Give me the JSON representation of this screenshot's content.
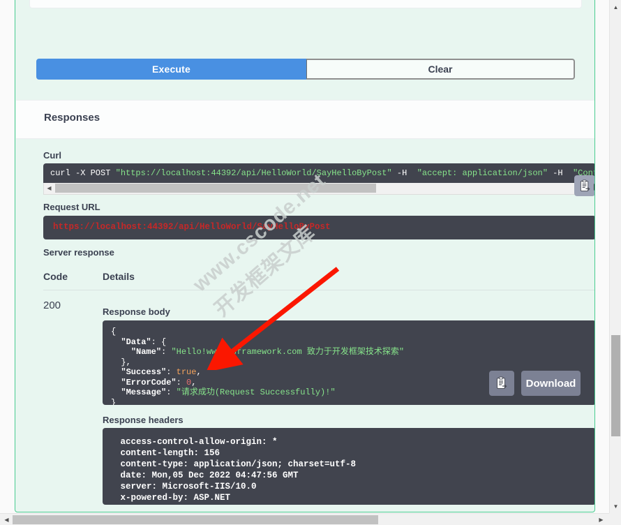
{
  "colors": {
    "execute_blue": "#4990e2",
    "opblock_border_green": "#49cc90",
    "opblock_bg": "#e8f6f0",
    "code_bg": "#41444e",
    "button_grey": "#7c8194",
    "json_string_green": "#86e38a",
    "json_bool_orange": "#f5a35c",
    "json_number_red": "#e86f6f",
    "url_red": "#c62828",
    "annotation_arrow_red": "#fb1700"
  },
  "buttons": {
    "execute": "Execute",
    "clear": "Clear",
    "download": "Download",
    "copy_icon_name": "copy-to-clipboard-icon"
  },
  "responses": {
    "title": "Responses",
    "curl_label": "Curl",
    "request_url_label": "Request URL",
    "server_response_label": "Server response",
    "column_code": "Code",
    "column_details": "Details",
    "status_code": "200",
    "response_body_label": "Response body",
    "response_headers_label": "Response headers"
  },
  "curl": {
    "command": "curl -X POST ",
    "url": "\"https://localhost:44392/api/HelloWorld/SayHelloByPost\"",
    "flag1": " -H  ",
    "header1": "\"accept: application/json\"",
    "flag2": " -H  ",
    "header2": "\"Content-Type:"
  },
  "request_url": {
    "value": "https://localhost:44392/api/HelloWorld/SayHelloByPost"
  },
  "response_body": {
    "l1": "{",
    "l2_key": "\"Data\"",
    "l2_rest": ": {",
    "l3_key": "\"Name\"",
    "l3_sep": ": ",
    "l3_val": "\"Hello!www.csframework.com 致力于开发框架技术探索\"",
    "l4": "},",
    "l5_key": "\"Success\"",
    "l5_sep": ": ",
    "l5_val": "true",
    "l5_end": ",",
    "l6_key": "\"ErrorCode\"",
    "l6_sep": ": ",
    "l6_val": "0",
    "l6_end": ",",
    "l7_key": "\"Message\"",
    "l7_sep": ": ",
    "l7_val": "\"请求成功(Request Successfully)!\"",
    "l8": "}"
  },
  "response_headers": {
    "lines": [
      " access-control-allow-origin: * ",
      " content-length: 156 ",
      " content-type: application/json; charset=utf-8 ",
      " date: Mon,05 Dec 2022 04:47:56 GMT ",
      " server: Microsoft-IIS/10.0 ",
      " x-powered-by: ASP.NET "
    ],
    "text": " access-control-allow-origin: * \n content-length: 156 \n content-type: application/json; charset=utf-8 \n date: Mon,05 Dec 2022 04:47:56 GMT \n server: Microsoft-IIS/10.0 \n x-powered-by: ASP.NET "
  },
  "watermark": {
    "line1": "www.cscode.net",
    "line2": "开发框架文库"
  },
  "scrollbars": {
    "up_arrow": "▲",
    "down_arrow": "▼",
    "left_arrow": "◀",
    "right_arrow": "▶"
  }
}
